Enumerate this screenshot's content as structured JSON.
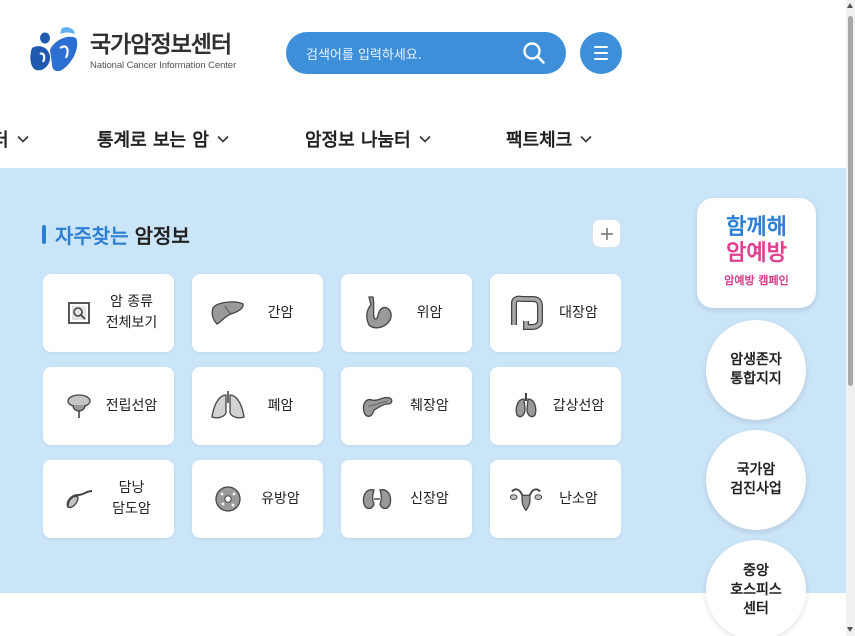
{
  "header": {
    "logo_ko": "국가암정보센터",
    "logo_en": "National Cancer Information Center",
    "search_placeholder": "검색어를 입력하세요.",
    "search_icon": "search-icon",
    "menu_icon": "hamburger-menu-icon"
  },
  "nav": {
    "items": [
      {
        "label": "터"
      },
      {
        "label": "통계로 보는 암"
      },
      {
        "label": "암정보 나눔터"
      },
      {
        "label": "팩트체크"
      }
    ]
  },
  "section": {
    "title_highlight": "자주찾는",
    "title_rest": "암정보",
    "plus_icon": "plus-icon"
  },
  "cancer_cards": [
    {
      "label": "암 종류\n전체보기",
      "icon": "search-document-icon"
    },
    {
      "label": "간암",
      "icon": "liver-icon"
    },
    {
      "label": "위암",
      "icon": "stomach-icon"
    },
    {
      "label": "대장암",
      "icon": "colon-icon"
    },
    {
      "label": "전립선암",
      "icon": "prostate-icon"
    },
    {
      "label": "폐암",
      "icon": "lungs-icon"
    },
    {
      "label": "췌장암",
      "icon": "pancreas-icon"
    },
    {
      "label": "갑상선암",
      "icon": "thyroid-icon"
    },
    {
      "label": "담낭\n담도암",
      "icon": "gallbladder-icon"
    },
    {
      "label": "유방암",
      "icon": "breast-icon"
    },
    {
      "label": "신장암",
      "icon": "kidney-icon"
    },
    {
      "label": "난소암",
      "icon": "ovary-icon"
    }
  ],
  "side": {
    "campaign_line1": "함께해",
    "campaign_line2": "암예방",
    "campaign_sub": "암예방 캠페인",
    "links": [
      {
        "label": "암생존자\n통합지지"
      },
      {
        "label": "국가암\n검진사업"
      },
      {
        "label": "중앙\n호스피스\n센터"
      }
    ]
  },
  "colors": {
    "accent": "#3d8fd9",
    "panel_bg": "#cae4f8",
    "title_blue": "#2d7fd3",
    "campaign_blue": "#2b7fd6",
    "campaign_pink": "#e0408f"
  }
}
